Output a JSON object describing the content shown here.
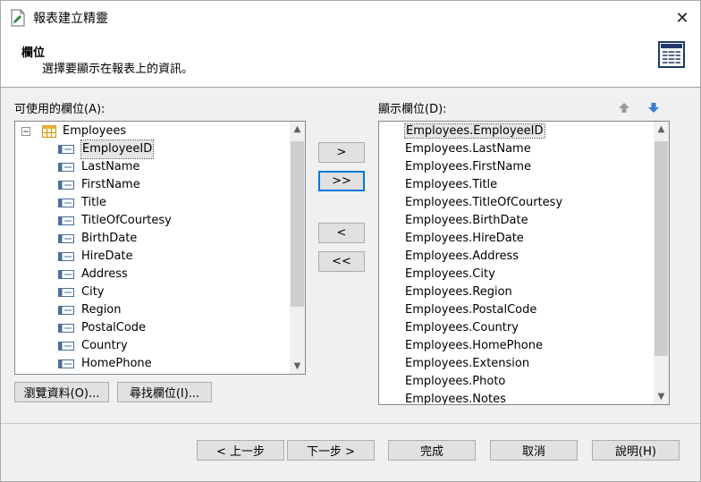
{
  "window": {
    "title": "報表建立精靈",
    "close_glyph": "✕"
  },
  "header": {
    "title": "欄位",
    "subtitle": "選擇要顯示在報表上的資訊。"
  },
  "available": {
    "label": "可使用的欄位(A):",
    "table_name": "Employees",
    "fields": [
      "EmployeeID",
      "LastName",
      "FirstName",
      "Title",
      "TitleOfCourtesy",
      "BirthDate",
      "HireDate",
      "Address",
      "City",
      "Region",
      "PostalCode",
      "Country",
      "HomePhone"
    ]
  },
  "display": {
    "label": "顯示欄位(D):",
    "fields": [
      "Employees.EmployeeID",
      "Employees.LastName",
      "Employees.FirstName",
      "Employees.Title",
      "Employees.TitleOfCourtesy",
      "Employees.BirthDate",
      "Employees.HireDate",
      "Employees.Address",
      "Employees.City",
      "Employees.Region",
      "Employees.PostalCode",
      "Employees.Country",
      "Employees.HomePhone",
      "Employees.Extension",
      "Employees.Photo",
      "Employees.Notes"
    ]
  },
  "move_buttons": {
    "add_one": ">",
    "add_all": ">>",
    "remove_one": "<",
    "remove_all": "<<"
  },
  "lower_buttons": {
    "browse": "瀏覽資料(O)...",
    "find": "尋找欄位(I)..."
  },
  "footer": {
    "back": "< 上一步",
    "next": "下一步 >",
    "finish": "完成",
    "cancel": "取消",
    "help": "說明(H)"
  },
  "colors": {
    "accent": "#0078d7",
    "selection_bg": "#e5e5e5"
  }
}
